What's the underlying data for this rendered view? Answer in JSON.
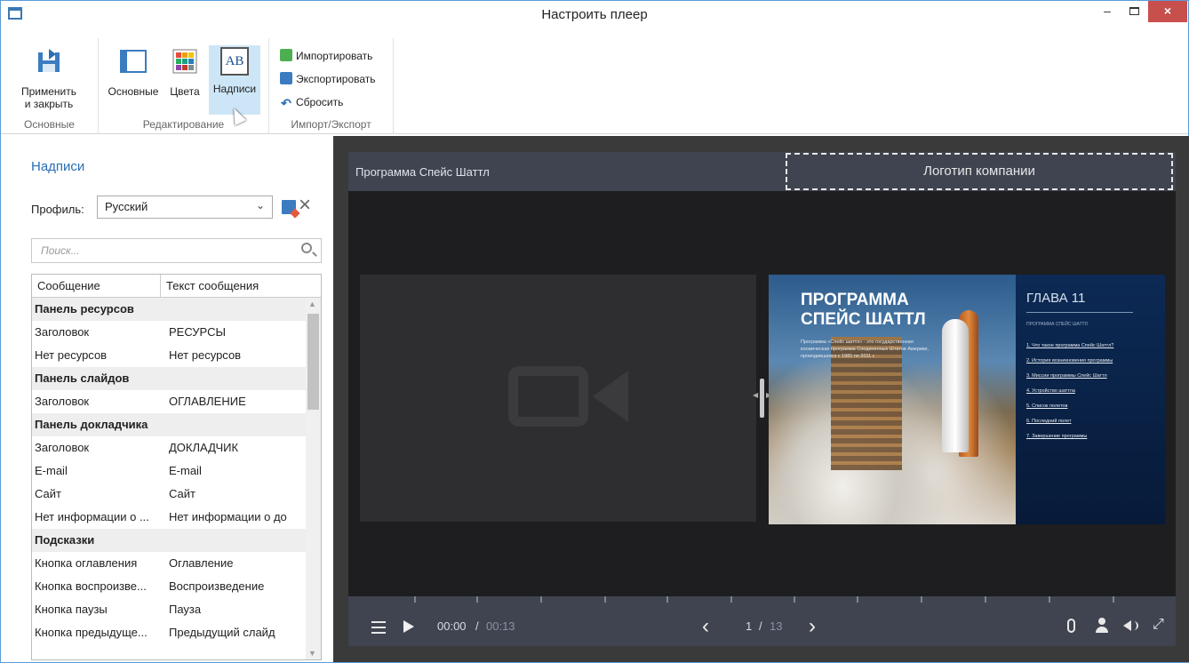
{
  "window": {
    "title": "Настроить плеер",
    "minimize": "–",
    "close": "×"
  },
  "ribbon": {
    "groups": [
      {
        "label": "Основные"
      },
      {
        "label": "Редактирование"
      },
      {
        "label": "Импорт/Экспорт"
      }
    ],
    "apply_close_line1": "Применить",
    "apply_close_line2": "и закрыть",
    "basic": "Основные",
    "colors": "Цвета",
    "labels": "Надписи",
    "labels_icon_text": "AB",
    "import": "Импортировать",
    "export": "Экспортировать",
    "reset": "Сбросить"
  },
  "panel": {
    "title": "Надписи",
    "profile_label": "Профиль:",
    "profile_value": "Русский",
    "search_placeholder": "Поиск...",
    "columns": [
      "Сообщение",
      "Текст сообщения"
    ],
    "rows": [
      {
        "group": "Панель ресурсов"
      },
      {
        "msg": "Заголовок",
        "text": "РЕСУРСЫ"
      },
      {
        "msg": "Нет ресурсов",
        "text": "Нет ресурсов"
      },
      {
        "group": "Панель слайдов"
      },
      {
        "msg": "Заголовок",
        "text": "ОГЛАВЛЕНИЕ"
      },
      {
        "group": "Панель докладчика"
      },
      {
        "msg": "Заголовок",
        "text": "ДОКЛАДЧИК"
      },
      {
        "msg": "E-mail",
        "text": "E-mail"
      },
      {
        "msg": "Сайт",
        "text": "Сайт"
      },
      {
        "msg": "Нет информации о ...",
        "text": "Нет информации о до"
      },
      {
        "group": "Подсказки"
      },
      {
        "msg": "Кнопка оглавления",
        "text": "Оглавление"
      },
      {
        "msg": "Кнопка воспроизве...",
        "text": "Воспроизведение"
      },
      {
        "msg": "Кнопка паузы",
        "text": "Пауза"
      },
      {
        "msg": "Кнопка предыдуще...",
        "text": "Предыдущий слайд"
      }
    ]
  },
  "player": {
    "title": "Программа Спейс Шаттл",
    "logo_placeholder": "Логотип компании",
    "time_current": "00:00",
    "time_separator": "/",
    "time_total": "00:13",
    "page_current": "1",
    "page_separator": "/",
    "page_total": "13",
    "slide": {
      "heading_line1": "ПРОГРАММА",
      "heading_line2": "СПЕЙС ШАТТЛ",
      "description": "Программа «Спейс шаттл» - это государственная космическая программа Соединенных Штатов Америки, проводившаяся с 1981 по 2011 г.",
      "chapter": "ГЛАВА 11",
      "chapter_subtitle": "ПРОГРАММА СПЕЙС ШАТТЛ",
      "toc": [
        "1. Что такое программа Спейс Шаттл?",
        "2. История возникновения программы",
        "3. Миссии программы Спейс Шаттл",
        "4. Устройство шаттла",
        "5. Список полетов",
        "6. Последний полет",
        "7. Завершение программы"
      ]
    }
  },
  "colors": {
    "accent": "#2a6fb5",
    "player_bar": "#3f4450",
    "player_bg": "#1e1e20",
    "close_button": "#c7504c",
    "active_tab": "#cde6f7"
  }
}
